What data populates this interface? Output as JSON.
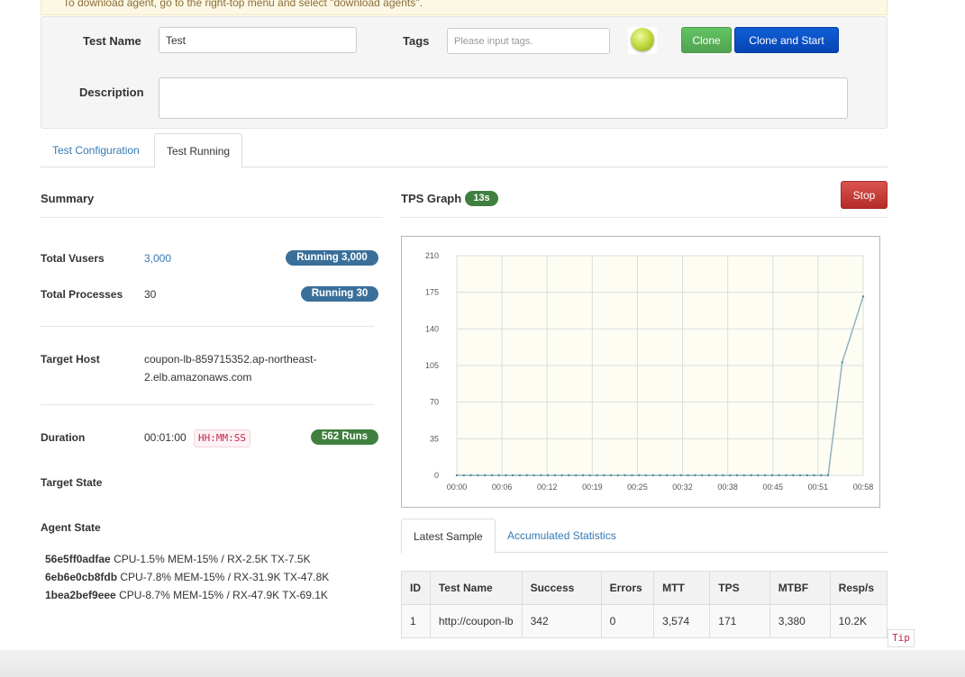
{
  "notice": {
    "text": "To download agent, go to the right-top menu and select \"download agents\"."
  },
  "header": {
    "test_name_label": "Test Name",
    "test_name_value": "Test",
    "tags_label": "Tags",
    "tags_placeholder": "Please input tags.",
    "description_label": "Description",
    "clone_label": "Clone",
    "clone_start_label": "Clone and Start"
  },
  "tabs": [
    {
      "label": "Test Configuration"
    },
    {
      "label": "Test Running"
    }
  ],
  "summary": {
    "title": "Summary",
    "total_vusers_label": "Total Vusers",
    "total_vusers_value": "3,000",
    "running_vusers_badge": "Running 3,000",
    "total_processes_label": "Total Processes",
    "total_processes_value": "30",
    "running_processes_badge": "Running 30",
    "target_host_label": "Target Host",
    "target_host_line1": "coupon-lb-859715352.ap-northeast-",
    "target_host_line2": "2.elb.amazonaws.com",
    "duration_label": "Duration",
    "duration_value": "00:01:00",
    "duration_format": "HH:MM:SS",
    "runs_badge": "562  Runs",
    "target_state_label": "Target State",
    "agent_state_label": "Agent State",
    "agents": [
      {
        "id": "56e5ff0adfae",
        "stats": "CPU-1.5% MEM-15% / RX-2.5K TX-7.5K"
      },
      {
        "id": "6eb6e0cb8fdb",
        "stats": "CPU-7.8% MEM-15% / RX-31.9K TX-47.8K"
      },
      {
        "id": "1bea2bef9eee",
        "stats": "CPU-8.7% MEM-15% / RX-47.9K TX-69.1K"
      }
    ]
  },
  "graph": {
    "title": "TPS Graph",
    "elapsed_badge": "13s",
    "stop_label": "Stop"
  },
  "chart_data": {
    "type": "line",
    "x": [
      "00:00",
      "00:06",
      "00:12",
      "00:19",
      "00:25",
      "00:32",
      "00:38",
      "00:45",
      "00:51",
      "00:58"
    ],
    "ylim": [
      0,
      210
    ],
    "yticks": [
      0,
      35,
      70,
      105,
      140,
      175,
      210
    ],
    "series": [
      {
        "values": [
          0,
          0,
          0,
          0,
          0,
          0,
          0,
          0,
          0,
          0,
          0,
          0,
          0,
          0,
          0,
          0,
          0,
          0,
          0,
          0,
          0,
          0,
          0,
          0,
          0,
          0,
          0,
          0,
          0,
          0,
          0,
          0,
          0,
          0,
          0,
          0,
          0,
          0,
          0,
          0,
          0,
          0,
          0,
          0,
          0,
          0,
          0,
          0,
          0,
          0,
          0,
          0,
          0,
          0,
          108,
          171
        ]
      }
    ],
    "series_x_seconds": [
      0,
      1,
      2,
      3,
      4,
      5,
      6,
      7,
      8,
      9,
      10,
      11,
      12,
      13,
      14,
      15,
      16,
      17,
      18,
      19,
      20,
      21,
      22,
      23,
      24,
      25,
      26,
      27,
      28,
      29,
      30,
      31,
      32,
      33,
      34,
      35,
      36,
      37,
      38,
      39,
      40,
      41,
      42,
      43,
      44,
      45,
      46,
      47,
      48,
      49,
      50,
      51,
      52,
      53,
      55,
      58
    ],
    "grid": true,
    "colors": {
      "line": "#8fb3bf",
      "plot_bg": "#fdfdf4"
    }
  },
  "sample_tabs": [
    {
      "label": "Latest Sample"
    },
    {
      "label": "Accumulated Statistics"
    }
  ],
  "stats_table": {
    "headers": [
      "ID",
      "Test Name",
      "Success",
      "Errors",
      "MTT",
      "TPS",
      "MTBF",
      "Resp/s"
    ],
    "rows": [
      [
        "1",
        "http://coupon-lb",
        "342",
        "0",
        "3,574",
        "171",
        "3,380",
        "10.2K"
      ]
    ]
  },
  "tip_label": "Tip"
}
